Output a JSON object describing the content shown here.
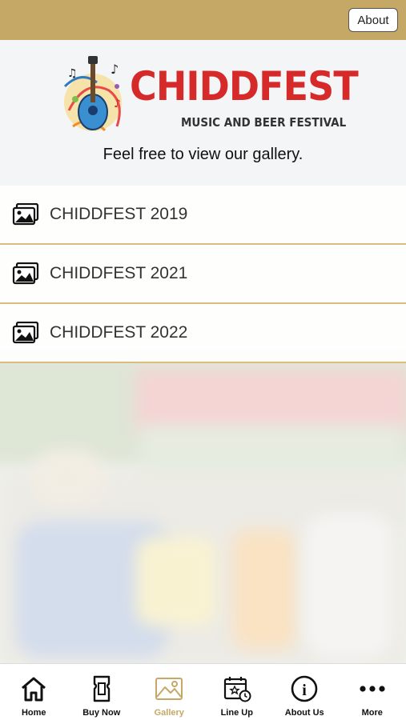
{
  "top_bar": {
    "about_label": "About"
  },
  "header": {
    "logo_title": "CHIDDFEST",
    "logo_subtitle": "MUSIC AND BEER FESTIVAL",
    "intro": "Feel free to view our gallery."
  },
  "gallery": {
    "items": [
      {
        "label": "CHIDDFEST 2019",
        "icon": "photos-icon"
      },
      {
        "label": "CHIDDFEST 2021",
        "icon": "photos-icon"
      },
      {
        "label": "CHIDDFEST 2022",
        "icon": "photos-icon"
      }
    ]
  },
  "nav": {
    "items": [
      {
        "label": "Home",
        "icon": "home-icon"
      },
      {
        "label": "Buy Now",
        "icon": "ticket-icon"
      },
      {
        "label": "Gallery",
        "icon": "image-icon"
      },
      {
        "label": "Line Up",
        "icon": "calendar-icon"
      },
      {
        "label": "About Us",
        "icon": "info-icon"
      },
      {
        "label": "More",
        "icon": "more-icon"
      }
    ],
    "active_color": "#c6a866"
  },
  "colors": {
    "gold": "#c6a866",
    "logo_red": "#d62a2a"
  }
}
